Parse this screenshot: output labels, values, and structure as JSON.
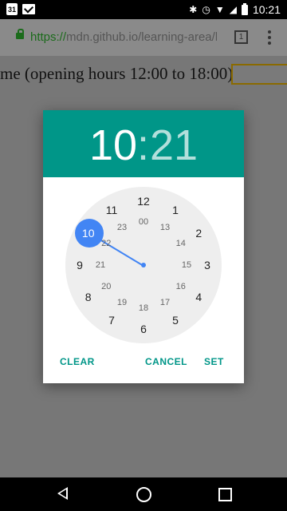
{
  "status_bar": {
    "calendar_day": "31",
    "time": "10:21",
    "icons": [
      "calendar-icon",
      "mail-icon",
      "bluetooth-icon",
      "alarm-icon",
      "signal-icon",
      "wifi-icon",
      "battery-icon"
    ]
  },
  "browser": {
    "url_scheme": "https://",
    "url_rest": "mdn.github.io/learning-area/ht",
    "tab_count": "1"
  },
  "page": {
    "label": "me (opening hours 12:00 to 18:00):"
  },
  "dialog": {
    "hours": "10",
    "colon": ":",
    "minutes": "21",
    "header_color": "#009688",
    "accent_color": "#4285f4",
    "selected_hour": "10",
    "outer_numbers": [
      "12",
      "1",
      "2",
      "3",
      "4",
      "5",
      "6",
      "7",
      "8",
      "9",
      "10",
      "11"
    ],
    "inner_numbers": [
      "00",
      "13",
      "14",
      "15",
      "16",
      "17",
      "18",
      "19",
      "20",
      "21",
      "22",
      "23"
    ],
    "buttons": {
      "clear": "CLEAR",
      "cancel": "CANCEL",
      "set": "SET"
    }
  }
}
